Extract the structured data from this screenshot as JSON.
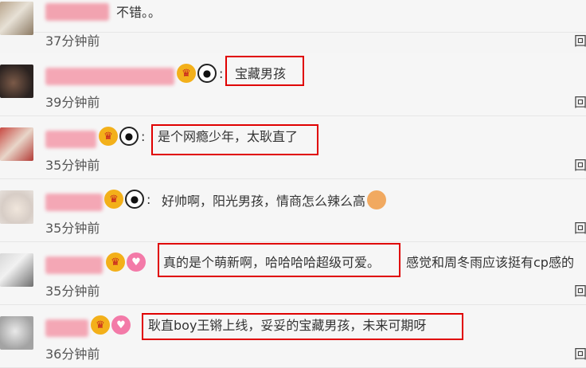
{
  "comments": [
    {
      "text": "不错。。",
      "time": "37分钟前",
      "reply": "回"
    },
    {
      "text": "宝藏男孩",
      "time": "39分钟前",
      "reply": "回"
    },
    {
      "text": "是个网瘾少年，太耿直了",
      "time": "35分钟前",
      "reply": "回"
    },
    {
      "text": "好帅啊，阳光男孩，情商怎么辣么高",
      "time": "35分钟前",
      "reply": "回"
    },
    {
      "text": "真的是个萌新啊，哈哈哈哈超级可爱。",
      "text_tail": "感觉和周冬雨应该挺有cp感的",
      "time": "35分钟前",
      "reply": "回"
    },
    {
      "text": "耿直boy王锵上线，妥妥的宝藏男孩，未来可期呀",
      "time": "36分钟前",
      "reply": "回"
    }
  ],
  "colon": ":",
  "highlight_color": "#e00000",
  "icons": [
    "crown-badge-icon",
    "panda-badge-icon",
    "heart-badge-icon",
    "grin-emoji-icon"
  ]
}
